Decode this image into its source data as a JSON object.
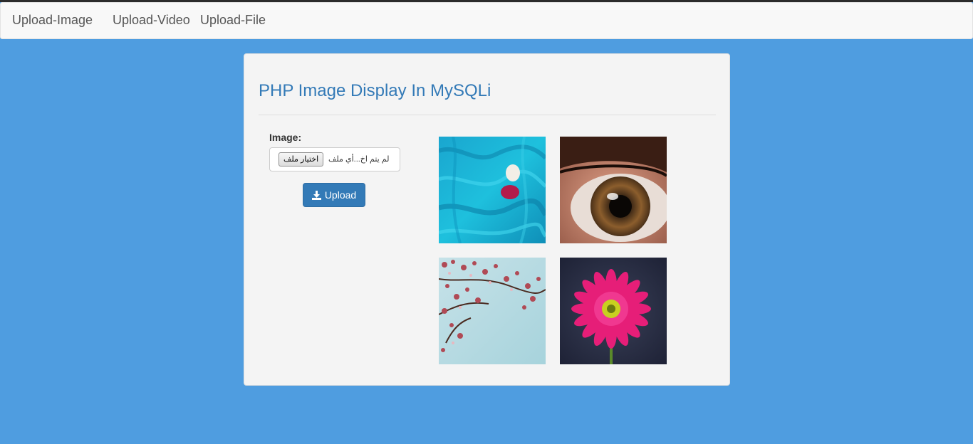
{
  "navbar": {
    "links": [
      {
        "label": "Upload-Image"
      },
      {
        "label": "Upload-Video"
      },
      {
        "label": "Upload-File"
      }
    ]
  },
  "panel": {
    "title": "PHP Image Display In MySQLi",
    "form": {
      "image_label": "Image:",
      "file_button_label": "اختيار ملف",
      "file_status": "لم يتم اخ...أي ملف",
      "upload_label": "Upload"
    },
    "gallery": [
      {
        "subject": "person on blue fabric"
      },
      {
        "subject": "close-up eye"
      },
      {
        "subject": "cherry blossom branches"
      },
      {
        "subject": "pink gerbera flower"
      }
    ]
  },
  "colors": {
    "background": "#4f9de0",
    "accent": "#337ab7",
    "navbar": "#f8f8f8",
    "panel": "#f4f4f4"
  },
  "icons": {
    "upload_icon": "download-icon"
  }
}
